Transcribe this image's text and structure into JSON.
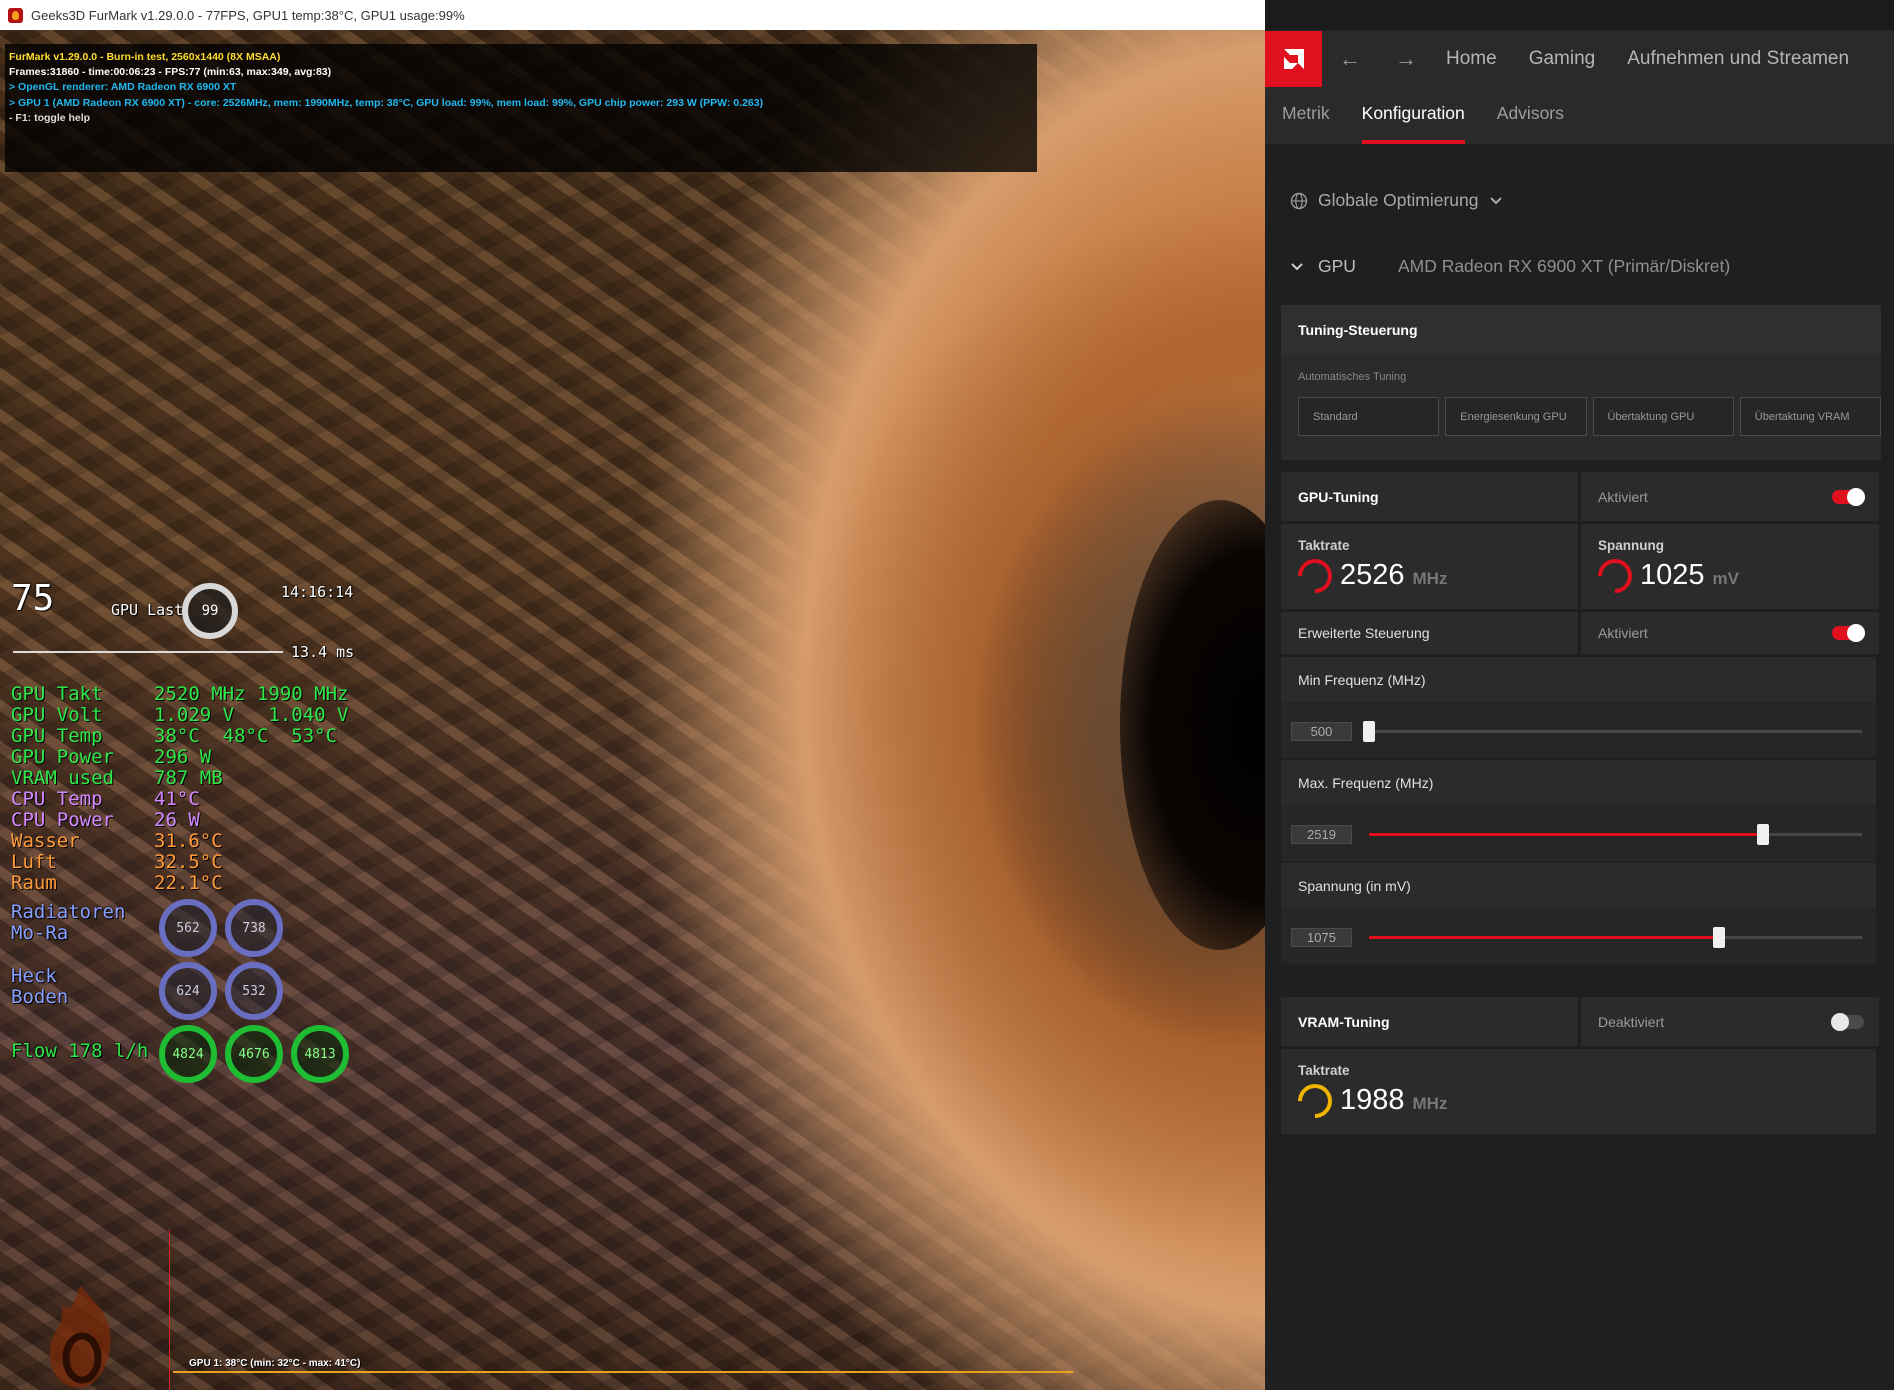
{
  "furmark": {
    "window_title": "Geeks3D FurMark v1.29.0.0 - 77FPS, GPU1 temp:38°C, GPU1 usage:99%",
    "info_lines": [
      "FurMark v1.29.0.0 - Burn-in test, 2560x1440 (8X MSAA)",
      "Frames:31860 - time:00:06:23 - FPS:77 (min:63, max:349, avg:83)",
      "> OpenGL renderer: AMD Radeon RX 6900 XT",
      "> GPU 1 (AMD Radeon RX 6900 XT) - core: 2526MHz, mem: 1990MHz, temp: 38°C, GPU load: 99%, mem load: 99%, GPU chip power: 293 W (PPW: 0.263)",
      "- F1: toggle help"
    ],
    "graph_label": "GPU 1: 38°C (min: 32°C - max: 41°C)"
  },
  "osd": {
    "fps": "75",
    "gpu_last_label": "GPU Last",
    "gpu_last_value": "99",
    "time": "14:16:14",
    "frametime": "13.4 ms",
    "stats": [
      {
        "key": "GPU Takt",
        "value": "2520 MHz 1990 MHz",
        "color": "green"
      },
      {
        "key": "GPU Volt",
        "value": "1.029 V   1.040 V",
        "color": "green"
      },
      {
        "key": "GPU Temp",
        "value": "38°C  48°C  53°C",
        "color": "green"
      },
      {
        "key": "GPU Power",
        "value": "296 W",
        "color": "green"
      },
      {
        "key": "VRAM used",
        "value": "787 MB",
        "color": "green"
      },
      {
        "key": "CPU Temp",
        "value": "41°C",
        "color": "purple"
      },
      {
        "key": "CPU Power",
        "value": "26 W",
        "color": "purple"
      },
      {
        "key": "Wasser",
        "value": "31.6°C",
        "color": "orange"
      },
      {
        "key": "Luft",
        "value": "32.5°C",
        "color": "orange"
      },
      {
        "key": "Raum",
        "value": "22.1°C",
        "color": "orange"
      }
    ],
    "radiatoren_label_1": "Radiatoren",
    "radiatoren_label_2": "Mo-Ra",
    "radiatoren_values": [
      "562",
      "738"
    ],
    "heck_label_1": "Heck",
    "heck_label_2": "Boden",
    "heck_values": [
      "624",
      "532"
    ],
    "flow_label": "Flow 178 l/h",
    "flow_values": [
      "4824",
      "4676",
      "4813"
    ]
  },
  "amd": {
    "nav": {
      "back_icon": "arrow-left-icon",
      "forward_icon": "arrow-right-icon",
      "items": [
        "Home",
        "Gaming",
        "Aufnehmen und Streamen"
      ]
    },
    "tabs": [
      "Metrik",
      "Konfiguration",
      "Advisors"
    ],
    "active_tab": "Konfiguration",
    "profile": "Globale Optimierung",
    "gpu_label": "GPU",
    "gpu_name": "AMD Radeon RX 6900 XT (Primär/Diskret)",
    "tuning_control": {
      "title": "Tuning-Steuerung",
      "auto_label": "Automatisches Tuning",
      "buttons": [
        "Standard",
        "Energiesenkung GPU",
        "Übertaktung GPU",
        "Übertaktung VRAM"
      ]
    },
    "gpu_tuning": {
      "title": "GPU-Tuning",
      "status": "Aktiviert",
      "clock_label": "Taktrate",
      "clock_value": "2526",
      "clock_unit": "MHz",
      "voltage_label": "Spannung",
      "voltage_value": "1025",
      "voltage_unit": "mV",
      "advanced_label": "Erweiterte Steuerung",
      "advanced_status": "Aktiviert",
      "min_freq_label": "Min Frequenz (MHz)",
      "min_freq_value": "500",
      "min_freq_fraction": 0.0,
      "max_freq_label": "Max. Frequenz (MHz)",
      "max_freq_value": "2519",
      "max_freq_fraction": 0.8,
      "voltage_slider_label": "Spannung (in mV)",
      "voltage_slider_value": "1075",
      "voltage_slider_fraction": 0.71
    },
    "vram_tuning": {
      "title": "VRAM-Tuning",
      "status": "Deaktiviert",
      "clock_label": "Taktrate",
      "clock_value": "1988",
      "clock_unit": "MHz"
    },
    "colors": {
      "accent": "#e0101e",
      "vram_gauge": "#f0b400"
    }
  }
}
